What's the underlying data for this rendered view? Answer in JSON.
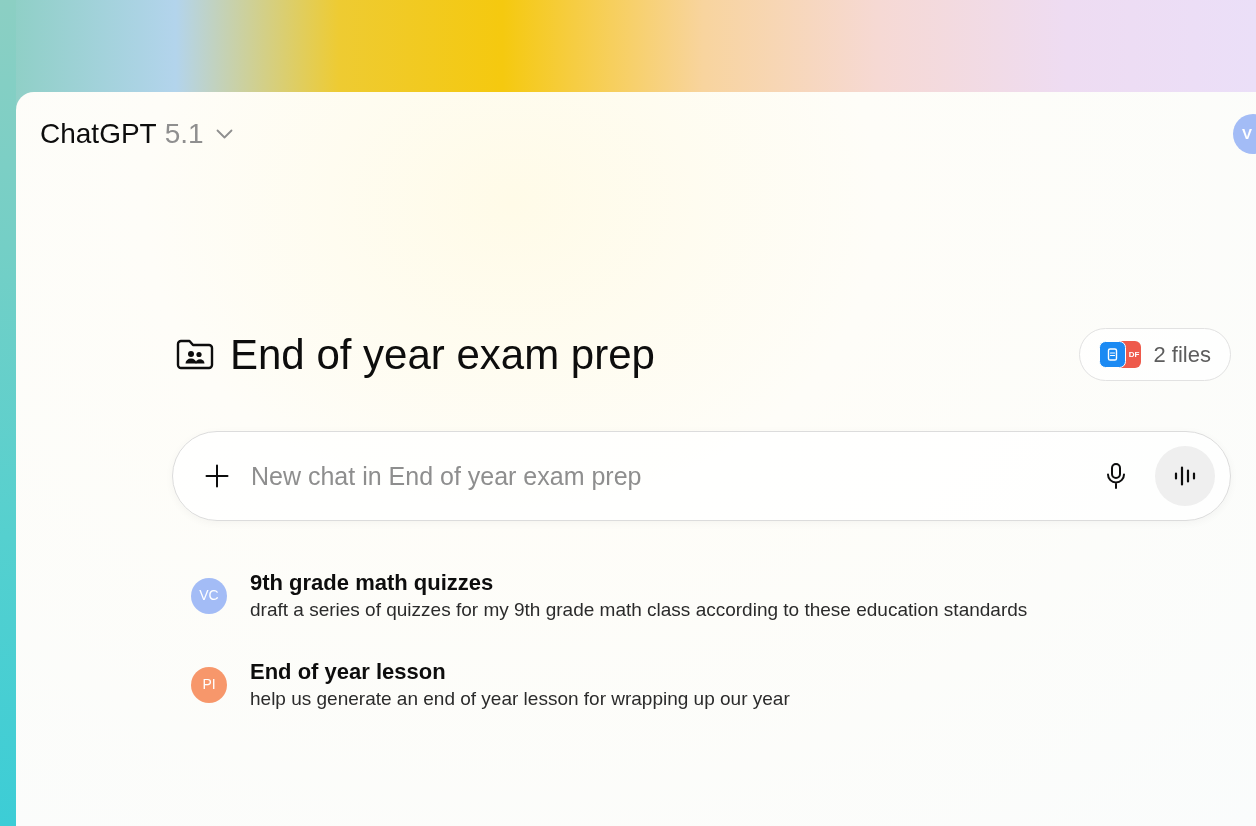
{
  "header": {
    "model_name": "ChatGPT",
    "model_version": "5.1"
  },
  "account": {
    "initials": "V"
  },
  "project": {
    "title": "End of year exam prep",
    "files": {
      "label": "2 files",
      "icons": [
        {
          "kind": "document"
        },
        {
          "kind": "pdf",
          "label": "DF"
        }
      ]
    }
  },
  "composer": {
    "placeholder": "New chat in End of year exam prep"
  },
  "chats": [
    {
      "initials": "VC",
      "color": "#a3bcf6",
      "title": "9th grade math quizzes",
      "preview": "draft a series of quizzes for my 9th grade math class according to these education standards"
    },
    {
      "initials": "PI",
      "color": "#f7976b",
      "title": "End of year lesson",
      "preview": "help us generate an end of year lesson for wrapping up our year"
    }
  ]
}
